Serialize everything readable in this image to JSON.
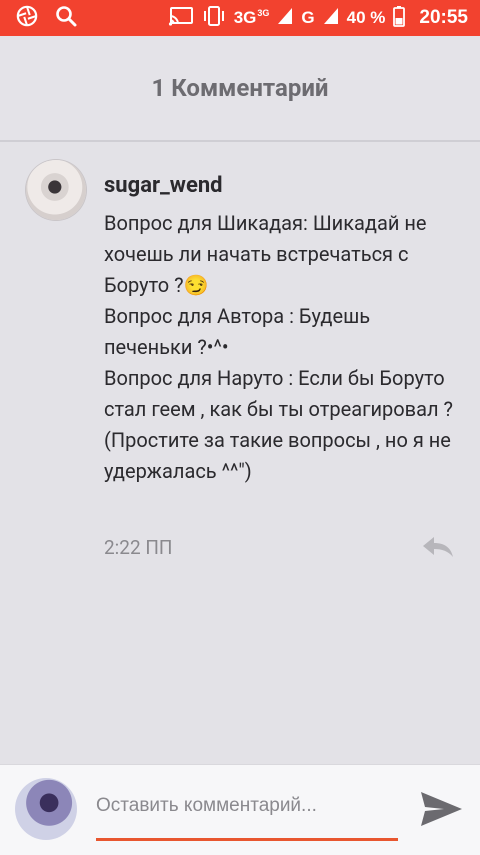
{
  "status_bar": {
    "network_primary": "3G",
    "network_primary_sup": "3G",
    "network_secondary": "G",
    "battery": "40 %",
    "time": "20:55"
  },
  "header": {
    "title": "1 Комментарий"
  },
  "comment": {
    "username": "sugar_wend",
    "text": "Вопрос для Шикадая: Шикадай не хочешь ли начать встречаться с Боруто ?😏\nВопрос для Автора : Будешь печеньки ?•^•\nВопрос для Наруто : Если бы Боруто стал геем , как бы ты отреагировал ?\n(Простите за такие вопросы , но я не удержалась ^^\")",
    "time": "2:22 ПП"
  },
  "compose": {
    "placeholder": "Оставить комментарий..."
  },
  "colors": {
    "status_bar": "#f2422f",
    "accent": "#e8562f",
    "background": "#e3e2e7"
  }
}
